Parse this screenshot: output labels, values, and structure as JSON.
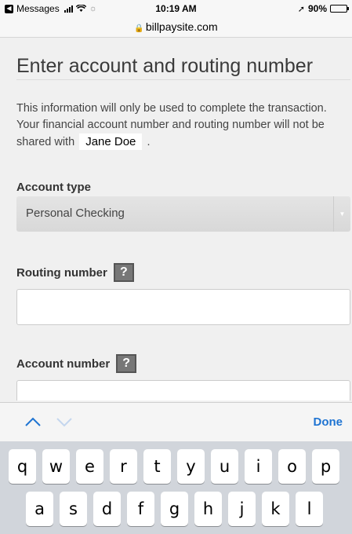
{
  "status_bar": {
    "back_app": "Messages",
    "time": "10:19 AM",
    "battery": "90%",
    "battery_level": 0.9
  },
  "browser": {
    "url": "billpaysite.com"
  },
  "page": {
    "title": "Enter account and routing number",
    "info_text_before": "This information will only be used to complete the transaction. Your financial account number and routing number will not be shared with",
    "payee_name": "Jane Doe",
    "info_text_after": ".",
    "account_type": {
      "label": "Account type",
      "selected": "Personal Checking"
    },
    "routing_number": {
      "label": "Routing number",
      "help": "?",
      "value": ""
    },
    "account_number": {
      "label": "Account number",
      "help": "?",
      "value": ""
    }
  },
  "keyboard": {
    "done_label": "Done",
    "row1": [
      "q",
      "w",
      "e",
      "r",
      "t",
      "y",
      "u",
      "i",
      "o",
      "p"
    ],
    "row2": [
      "a",
      "s",
      "d",
      "f",
      "g",
      "h",
      "j",
      "k",
      "l"
    ]
  }
}
